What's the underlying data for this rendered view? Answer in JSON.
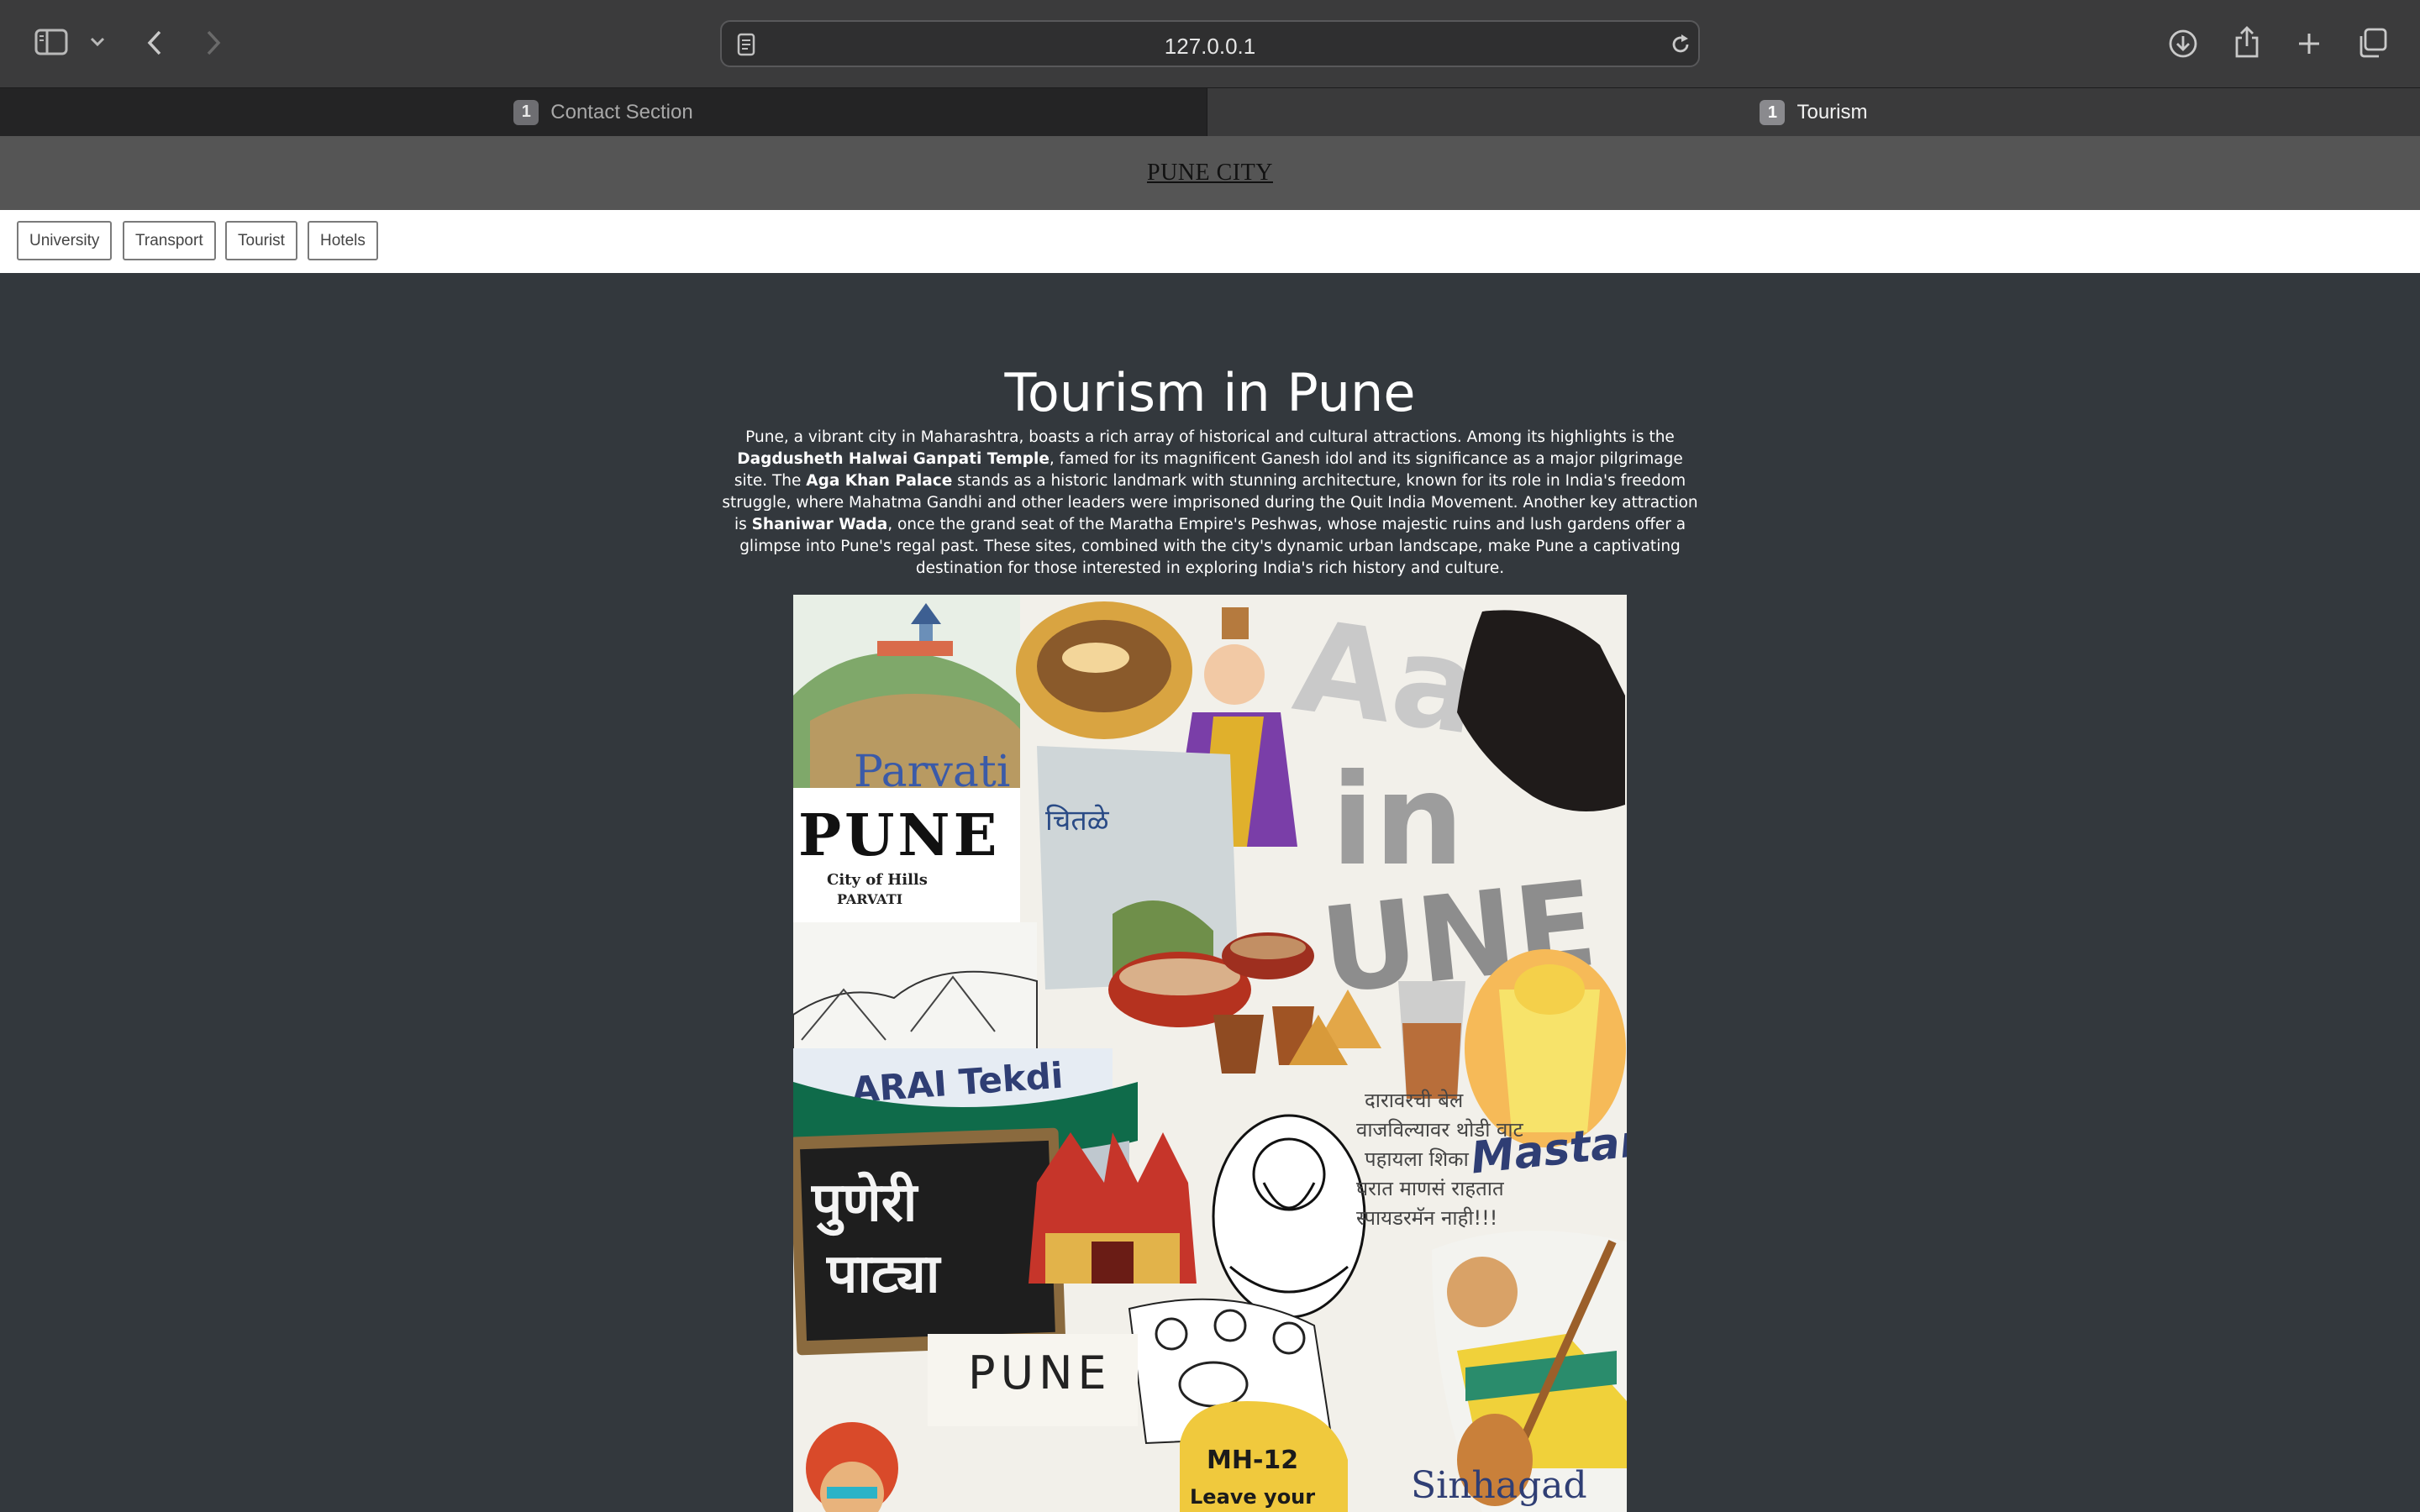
{
  "browser": {
    "url": "127.0.0.1",
    "tabs": [
      {
        "badge": "1",
        "label": "Contact Section"
      },
      {
        "badge": "1",
        "label": "Tourism"
      }
    ]
  },
  "site": {
    "title": "PUNE CITY",
    "nav": [
      "University",
      "Transport",
      "Tourist",
      "Hotels"
    ]
  },
  "main": {
    "heading": "Tourism in Pune",
    "intro": {
      "p1": "Pune, a vibrant city in Maharashtra, boasts a rich array of historical and cultural attractions. Among its highlights is the ",
      "b1": "Dagdusheth Halwai Ganpati Temple",
      "p2": ", famed for its magnificent Ganesh idol and its significance as a major pilgrimage site. The ",
      "b2": "Aga Khan Palace",
      "p3": " stands as a historic landmark with stunning architecture, known for its role in India's freedom struggle, where Mahatma Gandhi and other leaders were imprisoned during the Quit India Movement. Another key attraction is ",
      "b3": "Shaniwar Wada",
      "p4": ", once the grand seat of the Maratha Empire's Peshwas, whose majestic ruins and lush gardens offer a glimpse into Pune's regal past. These sites, combined with the city's dynamic urban landscape, make Pune a captivating destination for those interested in exploring India's rich history and culture."
    },
    "collage": {
      "labels": {
        "parvati": "Parvati",
        "pune_big": "PUNE",
        "city_of_hills": "City of Hills",
        "parvati_small": "PARVATI",
        "arai": "ARAI Tekdi",
        "puneri_1": "पुणेरी",
        "puneri_2": "पाट्या",
        "pune_bottom": "PUNE",
        "mh12": "MH-12",
        "leave": "Leave your",
        "mastani": "Mastani",
        "sinhagad": "Sinhagad",
        "marathi_1": "दारावरची बेल",
        "marathi_2": "वाजविल्यावर थोडी वाट",
        "marathi_3": "पहायला शिका",
        "marathi_4": "घरात माणसं राहतात",
        "marathi_5": "स्पायडरमॅन नाही!!!",
        "chitale": "चितळे"
      }
    }
  }
}
